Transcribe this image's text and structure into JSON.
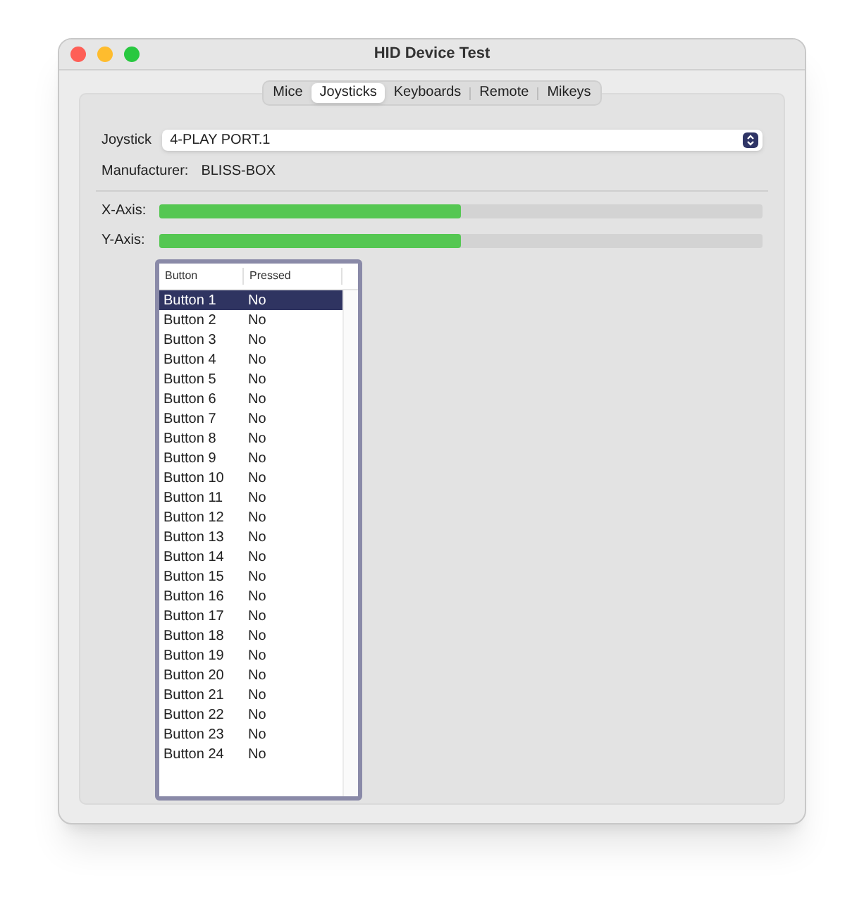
{
  "window": {
    "title": "HID Device Test"
  },
  "tabs": [
    {
      "label": "Mice",
      "selected": false
    },
    {
      "label": "Joysticks",
      "selected": true
    },
    {
      "label": "Keyboards",
      "selected": false
    },
    {
      "label": "Remote",
      "selected": false
    },
    {
      "label": "Mikeys",
      "selected": false
    }
  ],
  "joystick": {
    "label": "Joystick",
    "value": "4-PLAY PORT.1"
  },
  "manufacturer": {
    "label": "Manufacturer:",
    "value": "BLISS-BOX"
  },
  "axes": [
    {
      "label": "X-Axis:",
      "level": 0.5
    },
    {
      "label": "Y-Axis:",
      "level": 0.5
    }
  ],
  "table": {
    "columns": [
      "Button",
      "Pressed"
    ],
    "rows": [
      {
        "button": "Button 1",
        "pressed": "No",
        "selected": true
      },
      {
        "button": "Button 2",
        "pressed": "No",
        "selected": false
      },
      {
        "button": "Button 3",
        "pressed": "No",
        "selected": false
      },
      {
        "button": "Button 4",
        "pressed": "No",
        "selected": false
      },
      {
        "button": "Button 5",
        "pressed": "No",
        "selected": false
      },
      {
        "button": "Button 6",
        "pressed": "No",
        "selected": false
      },
      {
        "button": "Button 7",
        "pressed": "No",
        "selected": false
      },
      {
        "button": "Button 8",
        "pressed": "No",
        "selected": false
      },
      {
        "button": "Button 9",
        "pressed": "No",
        "selected": false
      },
      {
        "button": "Button 10",
        "pressed": "No",
        "selected": false
      },
      {
        "button": "Button 11",
        "pressed": "No",
        "selected": false
      },
      {
        "button": "Button 12",
        "pressed": "No",
        "selected": false
      },
      {
        "button": "Button 13",
        "pressed": "No",
        "selected": false
      },
      {
        "button": "Button 14",
        "pressed": "No",
        "selected": false
      },
      {
        "button": "Button 15",
        "pressed": "No",
        "selected": false
      },
      {
        "button": "Button 16",
        "pressed": "No",
        "selected": false
      },
      {
        "button": "Button 17",
        "pressed": "No",
        "selected": false
      },
      {
        "button": "Button 18",
        "pressed": "No",
        "selected": false
      },
      {
        "button": "Button 19",
        "pressed": "No",
        "selected": false
      },
      {
        "button": "Button 20",
        "pressed": "No",
        "selected": false
      },
      {
        "button": "Button 21",
        "pressed": "No",
        "selected": false
      },
      {
        "button": "Button 22",
        "pressed": "No",
        "selected": false
      },
      {
        "button": "Button 23",
        "pressed": "No",
        "selected": false
      },
      {
        "button": "Button 24",
        "pressed": "No",
        "selected": false
      }
    ]
  }
}
